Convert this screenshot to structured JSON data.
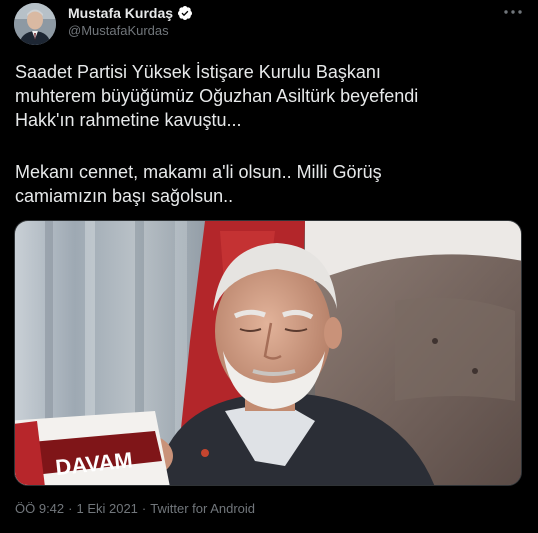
{
  "author": {
    "display_name": "Mustafa Kurdaş",
    "handle": "@MustafaKurdas",
    "verified": true
  },
  "icons": {
    "verified": "verified-badge-icon",
    "more": "more-horizontal-icon"
  },
  "tweet": {
    "paragraph_1": "Saadet Partisi Yüksek İstişare Kurulu Başkanı\nmuhterem büyüğümüz  Oğuzhan Asiltürk  beyefendi\nHakk'ın rahmetine kavuştu...",
    "paragraph_2": "Mekanı cennet, makamı a'li olsun.. Milli Görüş\ncamiamızın başı sağolsun.."
  },
  "media": {
    "book_cover_text": "DAVAM"
  },
  "meta": {
    "time": "ÖÖ 9:42",
    "separator_1": "·",
    "date": "1 Eki 2021",
    "separator_2": "·",
    "source": "Twitter for Android"
  },
  "colors": {
    "background": "#000000",
    "text": "#e7e9ea",
    "secondary_text": "#71767b",
    "verified_badge": "#ffffff"
  }
}
